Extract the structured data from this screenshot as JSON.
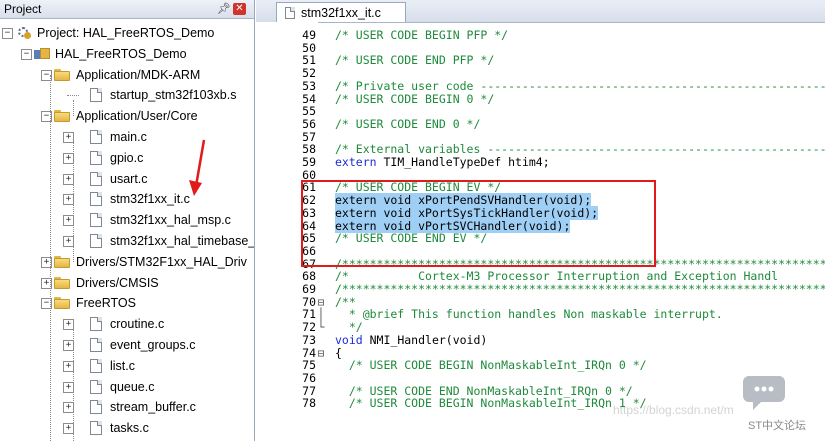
{
  "project_panel": {
    "title": "Project",
    "root": "Project: HAL_FreeRTOS_Demo",
    "target": "HAL_FreeRTOS_Demo",
    "groups": [
      {
        "name": "Application/MDK-ARM",
        "files": [
          "startup_stm32f103xb.s"
        ]
      },
      {
        "name": "Application/User/Core",
        "files": [
          "main.c",
          "gpio.c",
          "usart.c",
          "stm32f1xx_it.c",
          "stm32f1xx_hal_msp.c",
          "stm32f1xx_hal_timebase_"
        ]
      },
      {
        "name": "Drivers/STM32F1xx_HAL_Driv",
        "files": []
      },
      {
        "name": "Drivers/CMSIS",
        "files": []
      },
      {
        "name": "FreeRTOS",
        "files": [
          "croutine.c",
          "event_groups.c",
          "list.c",
          "queue.c",
          "stream_buffer.c",
          "tasks.c"
        ]
      }
    ]
  },
  "editor": {
    "tab_title": "stm32f1xx_it.c",
    "lines": [
      {
        "n": "49",
        "t": "/* USER CODE BEGIN PFP */",
        "k": "comment"
      },
      {
        "n": "50",
        "t": "",
        "k": "normal"
      },
      {
        "n": "51",
        "t": "/* USER CODE END PFP */",
        "k": "comment"
      },
      {
        "n": "52",
        "t": "",
        "k": "normal"
      },
      {
        "n": "53",
        "t": "/* Private user code ---------------------------------------------------",
        "k": "comment"
      },
      {
        "n": "54",
        "t": "/* USER CODE BEGIN 0 */",
        "k": "comment"
      },
      {
        "n": "55",
        "t": "",
        "k": "normal"
      },
      {
        "n": "56",
        "t": "/* USER CODE END 0 */",
        "k": "comment"
      },
      {
        "n": "57",
        "t": "",
        "k": "normal"
      },
      {
        "n": "58",
        "t": "/* External variables --------------------------------------------------",
        "k": "comment"
      },
      {
        "n": "59",
        "t": "extern TIM_HandleTypeDef htim4;",
        "k": "extern"
      },
      {
        "n": "60",
        "t": "",
        "k": "normal"
      },
      {
        "n": "61",
        "t": "/* USER CODE BEGIN EV */",
        "k": "comment"
      },
      {
        "n": "62",
        "t": "extern void xPortPendSVHandler(void);",
        "k": "selected"
      },
      {
        "n": "63",
        "t": "extern void xPortSysTickHandler(void);",
        "k": "selected"
      },
      {
        "n": "64",
        "t": "extern void vPortSVCHandler(void);",
        "k": "selected"
      },
      {
        "n": "65",
        "t": "/* USER CODE END EV */",
        "k": "comment"
      },
      {
        "n": "66",
        "t": "",
        "k": "normal"
      },
      {
        "n": "67",
        "t": "/*****************************************************************************",
        "k": "comment"
      },
      {
        "n": "68",
        "t": "/*          Cortex-M3 Processor Interruption and Exception Handl",
        "k": "comment"
      },
      {
        "n": "69",
        "t": "/*****************************************************************************",
        "k": "comment"
      },
      {
        "n": "70",
        "t": "/**",
        "k": "comment"
      },
      {
        "n": "71",
        "t": "  * @brief This function handles Non maskable interrupt.",
        "k": "comment"
      },
      {
        "n": "72",
        "t": "  */",
        "k": "comment"
      },
      {
        "n": "73",
        "t": "void NMI_Handler(void)",
        "k": "void"
      },
      {
        "n": "74",
        "t": "{",
        "k": "normal"
      },
      {
        "n": "75",
        "t": "  /* USER CODE BEGIN NonMaskableInt_IRQn 0 */",
        "k": "comment"
      },
      {
        "n": "76",
        "t": "",
        "k": "normal"
      },
      {
        "n": "77",
        "t": "  /* USER CODE END NonMaskableInt_IRQn 0 */",
        "k": "comment"
      },
      {
        "n": "78",
        "t": "  /* USER CODE BEGIN NonMaskableInt_IRQn 1 */",
        "k": "comment"
      }
    ]
  },
  "watermark": {
    "label": "ST中文论坛",
    "faint_text": "https://blog.csdn.net/m"
  },
  "colors": {
    "comment": "#1e8a3b",
    "keyword": "#1d2bd8",
    "selection": "#9fcff5",
    "highlight_box": "#e01b1b",
    "arrow": "#e01b1b"
  },
  "icons": {
    "close": "close-icon",
    "pin": "pin-icon",
    "folder": "folder-icon",
    "file": "file-icon"
  }
}
